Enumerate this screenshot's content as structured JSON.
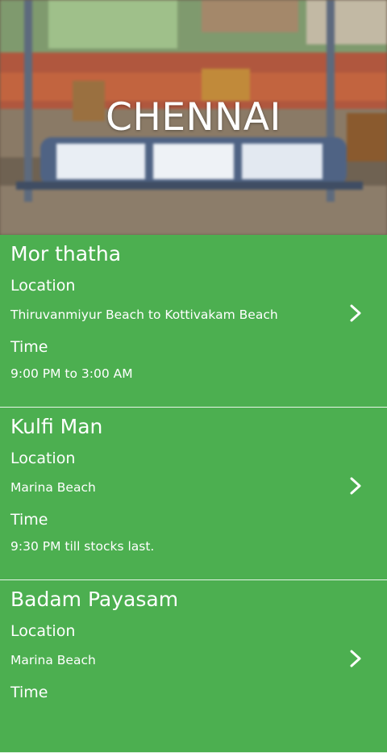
{
  "header": {
    "title": "CHENNAI"
  },
  "icons": {
    "chevron": "chevron-right-icon"
  },
  "colors": {
    "card_background": "#4caf50",
    "text": "#ffffff"
  },
  "items": [
    {
      "name": "Mor thatha",
      "location_label": "Location",
      "location": "Thiruvanmiyur Beach to Kottivakam Beach",
      "time_label": "Time",
      "time": "9:00 PM to 3:00 AM"
    },
    {
      "name": "Kulfi Man",
      "location_label": "Location",
      "location": "Marina Beach",
      "time_label": "Time",
      "time": "9:30 PM till stocks last."
    },
    {
      "name": "Badam Payasam",
      "location_label": "Location",
      "location": "Marina Beach",
      "time_label": "Time",
      "time": ""
    }
  ]
}
